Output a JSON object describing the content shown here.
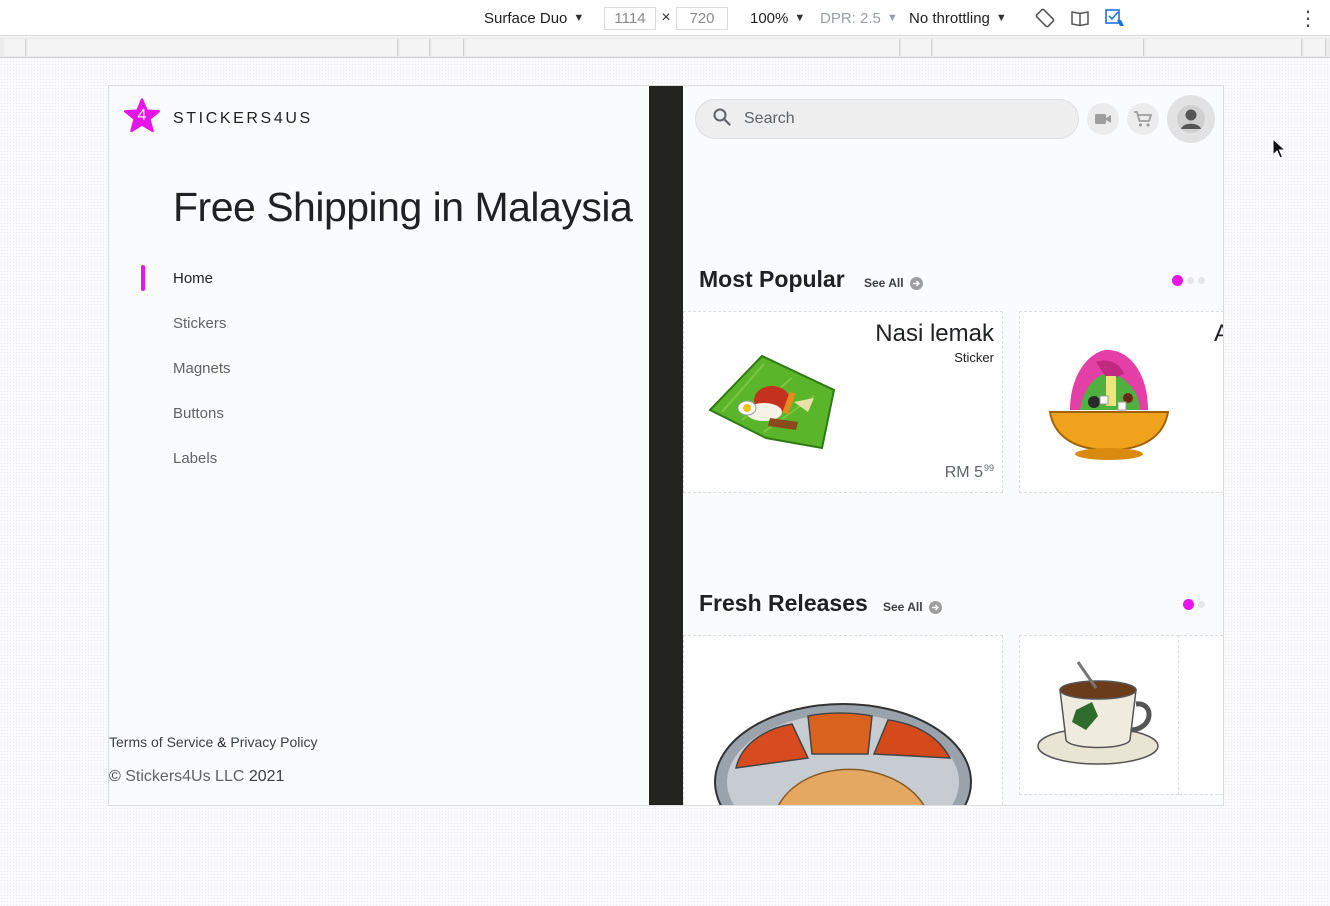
{
  "devtools": {
    "device": "Surface Duo",
    "width": "1114",
    "times": "×",
    "height": "720",
    "zoom": "100%",
    "dpr": "DPR: 2.5",
    "throttling": "No throttling",
    "caret": "▼",
    "more": "⋮"
  },
  "app": {
    "brand": "STICKERS4US",
    "logo_glyph": "4",
    "headline": "Free Shipping in Malaysia",
    "nav": [
      {
        "label": "Home"
      },
      {
        "label": "Stickers"
      },
      {
        "label": "Magnets"
      },
      {
        "label": "Buttons"
      },
      {
        "label": "Labels"
      }
    ],
    "legal": {
      "terms": "Terms of Service",
      "amp": "&",
      "privacy": "Privacy Policy"
    },
    "copyright": {
      "symbol": "©",
      "company": "Stickers4Us LLC",
      "year": "2021"
    },
    "search": {
      "placeholder": "Search"
    },
    "sections": {
      "popular": {
        "title": "Most Popular",
        "see_all": "See All",
        "cards": [
          {
            "name": "Nasi lemak",
            "type": "Sticker",
            "price_main": "RM 5",
            "price_cents": "99"
          },
          {
            "name_peek": "A"
          }
        ]
      },
      "fresh": {
        "title": "Fresh Releases",
        "see_all": "See All"
      }
    }
  },
  "colors": {
    "accent": "#e715e7",
    "hinge": "#232420"
  },
  "icons": [
    "search-icon",
    "video-icon",
    "cart-icon",
    "account-icon",
    "arrow-right-icon",
    "rotate-icon",
    "dual-screen-icon",
    "sensors-icon"
  ]
}
